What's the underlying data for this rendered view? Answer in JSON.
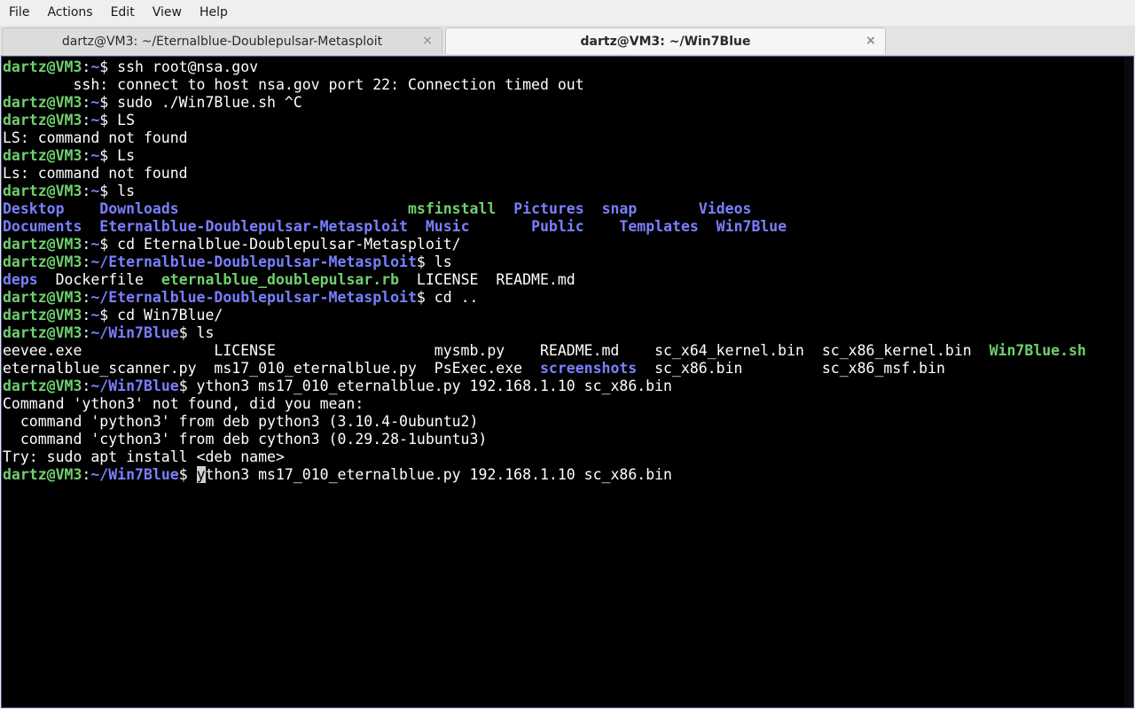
{
  "menu": [
    "File",
    "Actions",
    "Edit",
    "View",
    "Help"
  ],
  "tabs": [
    {
      "label": "dartz@VM3: ~/Eternalblue-Doublepulsar-Metasploit",
      "close": "×"
    },
    {
      "label": "dartz@VM3: ~/Win7Blue",
      "close": "×"
    }
  ],
  "colors": {
    "prompt_user": "#6ed06e",
    "prompt_path": "#7a7fff",
    "directory": "#7a7fff",
    "executable": "#6ed06e",
    "background": "#000000"
  },
  "terminal": {
    "lines": [
      [
        {
          "t": "dartz@VM3",
          "c": "user"
        },
        {
          "t": ":"
        },
        {
          "t": "~",
          "c": "path"
        },
        {
          "t": "$ ssh root@nsa.gov"
        }
      ],
      [
        {
          "t": "        ssh: connect to host nsa.gov port 22: Connection timed out"
        }
      ],
      [
        {
          "t": "dartz@VM3",
          "c": "user"
        },
        {
          "t": ":"
        },
        {
          "t": "~",
          "c": "path"
        },
        {
          "t": "$ sudo ./Win7Blue.sh ^C"
        }
      ],
      [
        {
          "t": "dartz@VM3",
          "c": "user"
        },
        {
          "t": ":"
        },
        {
          "t": "~",
          "c": "path"
        },
        {
          "t": "$ LS"
        }
      ],
      [
        {
          "t": "LS: command not found"
        }
      ],
      [
        {
          "t": "dartz@VM3",
          "c": "user"
        },
        {
          "t": ":"
        },
        {
          "t": "~",
          "c": "path"
        },
        {
          "t": "$ Ls"
        }
      ],
      [
        {
          "t": "Ls: command not found"
        }
      ],
      [
        {
          "t": "dartz@VM3",
          "c": "user"
        },
        {
          "t": ":"
        },
        {
          "t": "~",
          "c": "path"
        },
        {
          "t": "$ ls"
        }
      ],
      [
        {
          "t": "Desktop",
          "c": "dir"
        },
        {
          "t": "    "
        },
        {
          "t": "Downloads",
          "c": "dir"
        },
        {
          "t": "                          "
        },
        {
          "t": "msfinstall",
          "c": "exe"
        },
        {
          "t": "  "
        },
        {
          "t": "Pictures",
          "c": "dir"
        },
        {
          "t": "  "
        },
        {
          "t": "snap",
          "c": "dir"
        },
        {
          "t": "       "
        },
        {
          "t": "Videos",
          "c": "dir"
        }
      ],
      [
        {
          "t": "Documents",
          "c": "dir"
        },
        {
          "t": "  "
        },
        {
          "t": "Eternalblue-Doublepulsar-Metasploit",
          "c": "dir"
        },
        {
          "t": "  "
        },
        {
          "t": "Music",
          "c": "dir"
        },
        {
          "t": "       "
        },
        {
          "t": "Public",
          "c": "dir"
        },
        {
          "t": "    "
        },
        {
          "t": "Templates",
          "c": "dir"
        },
        {
          "t": "  "
        },
        {
          "t": "Win7Blue",
          "c": "dir"
        }
      ],
      [
        {
          "t": "dartz@VM3",
          "c": "user"
        },
        {
          "t": ":"
        },
        {
          "t": "~",
          "c": "path"
        },
        {
          "t": "$ cd Eternalblue-Doublepulsar-Metasploit/"
        }
      ],
      [
        {
          "t": "dartz@VM3",
          "c": "user"
        },
        {
          "t": ":"
        },
        {
          "t": "~/Eternalblue-Doublepulsar-Metasploit",
          "c": "path"
        },
        {
          "t": "$ ls"
        }
      ],
      [
        {
          "t": "deps",
          "c": "dir"
        },
        {
          "t": "  Dockerfile  "
        },
        {
          "t": "eternalblue_doublepulsar.rb",
          "c": "exe"
        },
        {
          "t": "  LICENSE  README.md"
        }
      ],
      [
        {
          "t": "dartz@VM3",
          "c": "user"
        },
        {
          "t": ":"
        },
        {
          "t": "~/Eternalblue-Doublepulsar-Metasploit",
          "c": "path"
        },
        {
          "t": "$ cd .."
        }
      ],
      [
        {
          "t": "dartz@VM3",
          "c": "user"
        },
        {
          "t": ":"
        },
        {
          "t": "~",
          "c": "path"
        },
        {
          "t": "$ cd Win7Blue/"
        }
      ],
      [
        {
          "t": "dartz@VM3",
          "c": "user"
        },
        {
          "t": ":"
        },
        {
          "t": "~/Win7Blue",
          "c": "path"
        },
        {
          "t": "$ ls"
        }
      ],
      [
        {
          "t": "eevee.exe               LICENSE                  mysmb.py    README.md    sc_x64_kernel.bin  sc_x86_kernel.bin  "
        },
        {
          "t": "Win7Blue.sh",
          "c": "exe"
        }
      ],
      [
        {
          "t": "eternalblue_scanner.py  ms17_010_eternalblue.py  PsExec.exe  "
        },
        {
          "t": "screenshots",
          "c": "dir"
        },
        {
          "t": "  sc_x86.bin         sc_x86_msf.bin"
        }
      ],
      [
        {
          "t": "dartz@VM3",
          "c": "user"
        },
        {
          "t": ":"
        },
        {
          "t": "~/Win7Blue",
          "c": "path"
        },
        {
          "t": "$ ython3 ms17_010_eternalblue.py 192.168.1.10 sc_x86.bin"
        }
      ],
      [
        {
          "t": "Command 'ython3' not found, did you mean:"
        }
      ],
      [
        {
          "t": "  command 'python3' from deb python3 (3.10.4-0ubuntu2)"
        }
      ],
      [
        {
          "t": "  command 'cython3' from deb cython3 (0.29.28-1ubuntu3)"
        }
      ],
      [
        {
          "t": "Try: sudo apt install <deb name>"
        }
      ],
      [
        {
          "t": "dartz@VM3",
          "c": "user"
        },
        {
          "t": ":"
        },
        {
          "t": "~/Win7Blue",
          "c": "path"
        },
        {
          "t": "$ "
        },
        {
          "t": "y",
          "c": "cursor"
        },
        {
          "t": "thon3 ms17_010_eternalblue.py 192.168.1.10 sc_x86.bin"
        }
      ]
    ]
  }
}
